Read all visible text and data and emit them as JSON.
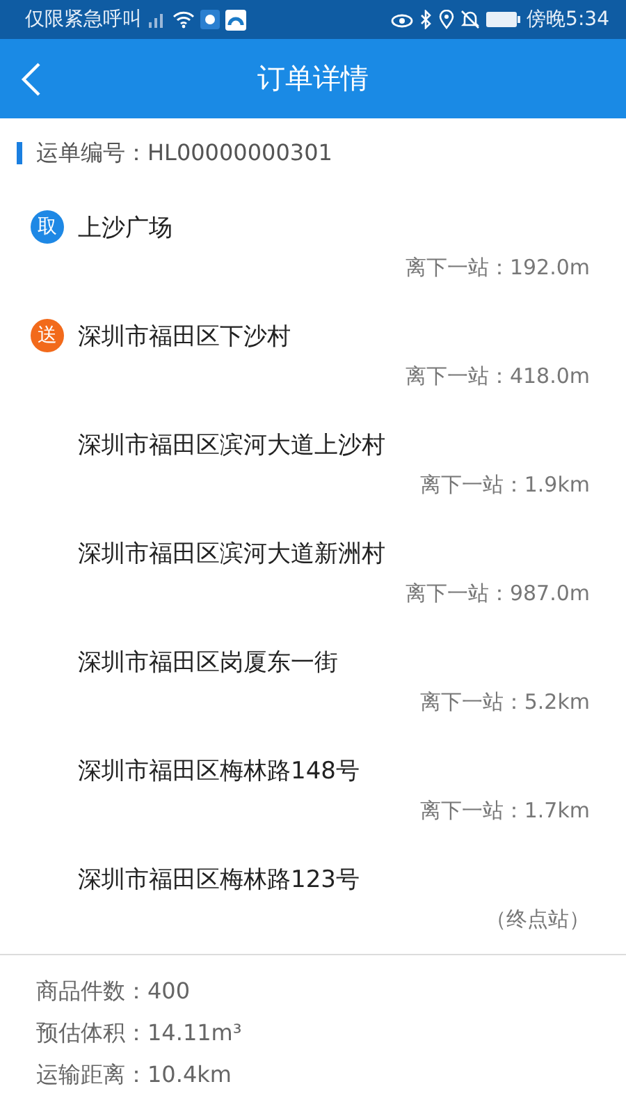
{
  "status_bar": {
    "carrier": "仅限紧急呼叫",
    "time": "傍晚5:34"
  },
  "header": {
    "title": "订单详情"
  },
  "order": {
    "label": "运单编号：HL00000000301"
  },
  "stops": [
    {
      "kind": "pickup",
      "badge": "取",
      "name": "上沙广场",
      "distance": "离下一站：192.0m"
    },
    {
      "kind": "delivery",
      "badge": "送",
      "name": "深圳市福田区下沙村",
      "distance": "离下一站：418.0m"
    },
    {
      "kind": "plain",
      "name": "深圳市福田区滨河大道上沙村",
      "distance": "离下一站：1.9km"
    },
    {
      "kind": "plain",
      "name": "深圳市福田区滨河大道新洲村",
      "distance": "离下一站：987.0m"
    },
    {
      "kind": "plain",
      "name": "深圳市福田区岗厦东一街",
      "distance": "离下一站：5.2km"
    },
    {
      "kind": "plain",
      "name": "深圳市福田区梅林路148号",
      "distance": "离下一站：1.7km"
    },
    {
      "kind": "plain",
      "name": "深圳市福田区梅林路123号",
      "distance": "（终点站）"
    }
  ],
  "summary": [
    "商品件数：400",
    "预估体积：14.11m³",
    "运输距离：10.4km"
  ]
}
